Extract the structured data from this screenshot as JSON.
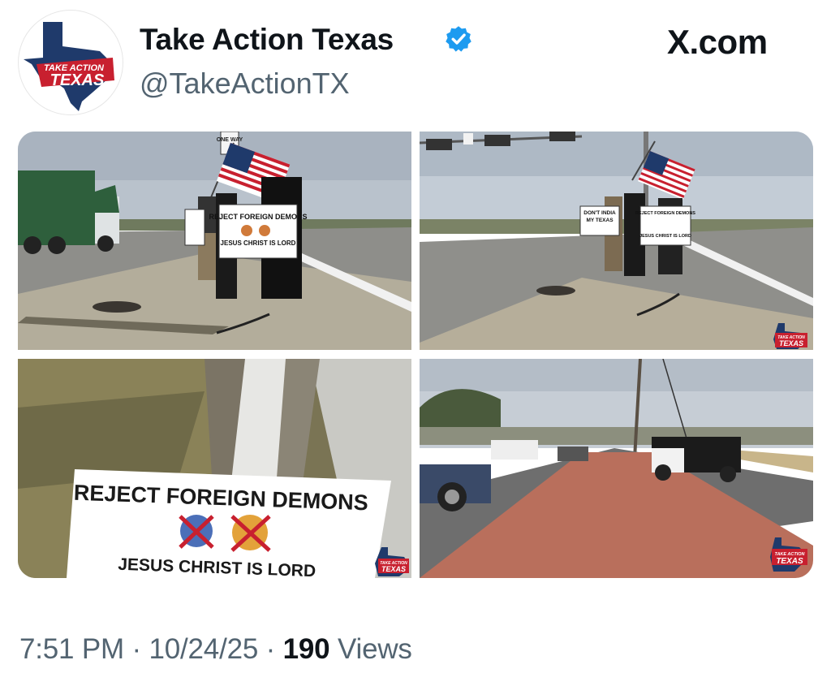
{
  "tweet": {
    "display_name": "Take Action Texas",
    "handle": "@TakeActionTX",
    "verified": true,
    "source_label": "X.com",
    "avatar_text_top": "TAKE ACTION",
    "avatar_text_bottom": "TEXAS",
    "time": "7:51 PM",
    "separator": "·",
    "date": "10/24/25",
    "views_count": "190",
    "views_label": "Views"
  },
  "media": {
    "photo1": {
      "sign_line1": "REJECT FOREIGN DEMONS",
      "sign_line2": "JESUS CHRIST IS LORD",
      "street_sign": "ONE WAY"
    },
    "photo2": {
      "sign_left_line1": "DON'T INDIA",
      "sign_left_line2": "MY TEXAS",
      "sign_right_line1": "REJECT FOREIGN DEMONS",
      "sign_right_line2": "JESUS CHRIST IS LORD",
      "watermark_top": "TAKE ACTION",
      "watermark_bottom": "TEXAS"
    },
    "photo3": {
      "sign_line1": "REJECT FOREIGN DEMONS",
      "sign_line2": "JESUS CHRIST IS LORD",
      "watermark_top": "TAKE ACTION",
      "watermark_bottom": "TEXAS"
    },
    "photo4": {
      "watermark_top": "TAKE ACTION",
      "watermark_bottom": "TEXAS"
    }
  },
  "icons": {
    "verified": "verified-badge-icon",
    "avatar": "texas-map-logo"
  },
  "colors": {
    "verified_blue": "#1d9bf0",
    "texas_red": "#c8202f",
    "texas_navy": "#1f3a6b",
    "secondary_text": "#536471"
  }
}
